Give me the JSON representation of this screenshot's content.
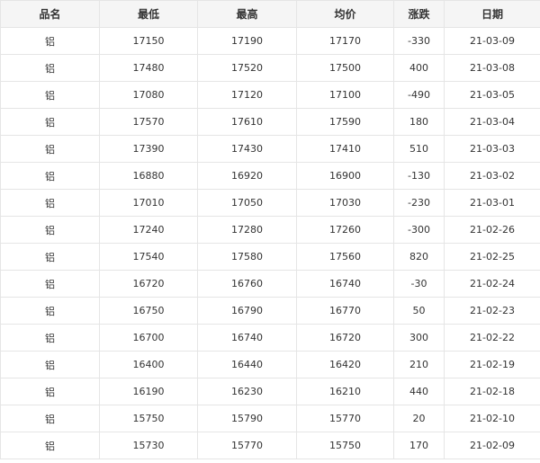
{
  "table": {
    "headers": [
      "品名",
      "最低",
      "最高",
      "均价",
      "涨跌",
      "日期"
    ],
    "rows": [
      [
        "铝",
        "17150",
        "17190",
        "17170",
        "-330",
        "21-03-09"
      ],
      [
        "铝",
        "17480",
        "17520",
        "17500",
        "400",
        "21-03-08"
      ],
      [
        "铝",
        "17080",
        "17120",
        "17100",
        "-490",
        "21-03-05"
      ],
      [
        "铝",
        "17570",
        "17610",
        "17590",
        "180",
        "21-03-04"
      ],
      [
        "铝",
        "17390",
        "17430",
        "17410",
        "510",
        "21-03-03"
      ],
      [
        "铝",
        "16880",
        "16920",
        "16900",
        "-130",
        "21-03-02"
      ],
      [
        "铝",
        "17010",
        "17050",
        "17030",
        "-230",
        "21-03-01"
      ],
      [
        "铝",
        "17240",
        "17280",
        "17260",
        "-300",
        "21-02-26"
      ],
      [
        "铝",
        "17540",
        "17580",
        "17560",
        "820",
        "21-02-25"
      ],
      [
        "铝",
        "16720",
        "16760",
        "16740",
        "-30",
        "21-02-24"
      ],
      [
        "铝",
        "16750",
        "16790",
        "16770",
        "50",
        "21-02-23"
      ],
      [
        "铝",
        "16700",
        "16740",
        "16720",
        "300",
        "21-02-22"
      ],
      [
        "铝",
        "16400",
        "16440",
        "16420",
        "210",
        "21-02-19"
      ],
      [
        "铝",
        "16190",
        "16230",
        "16210",
        "440",
        "21-02-18"
      ],
      [
        "铝",
        "15750",
        "15790",
        "15770",
        "20",
        "21-02-10"
      ],
      [
        "铝",
        "15730",
        "15770",
        "15750",
        "170",
        "21-02-09"
      ]
    ]
  }
}
